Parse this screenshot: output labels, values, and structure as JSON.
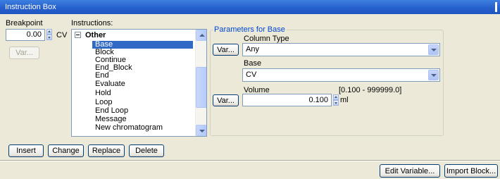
{
  "window": {
    "title": "Instruction Box"
  },
  "breakpoint": {
    "label": "Breakpoint",
    "value": "0.00",
    "unit": "CV",
    "var_button": "Var..."
  },
  "instructions": {
    "label": "Instructions:",
    "group": "Other",
    "items": [
      {
        "label": "Base",
        "selected": true
      },
      {
        "label": "Block"
      },
      {
        "label": "Continue"
      },
      {
        "label": "End_Block"
      },
      {
        "label": "End"
      },
      {
        "label": "Evaluate"
      },
      {
        "label": "Hold"
      },
      {
        "label": "Loop"
      },
      {
        "label": "End Loop"
      },
      {
        "label": "Message"
      },
      {
        "label": "New chromatogram"
      }
    ]
  },
  "parameters": {
    "title": "Parameters for Base",
    "column_type": {
      "label": "Column Type",
      "value": "Any",
      "var_button": "Var..."
    },
    "base": {
      "label": "Base",
      "value": "CV"
    },
    "volume": {
      "label": "Volume",
      "range": "[0.100 - 999999.0]",
      "value": "0.100",
      "unit": "ml",
      "var_button": "Var..."
    }
  },
  "actions": {
    "insert": "Insert",
    "change": "Change",
    "replace": "Replace",
    "delete": "Delete"
  },
  "footer": {
    "edit_variable": "Edit Variable...",
    "import_block": "Import Block..."
  },
  "colors": {
    "titlebar": "#2660cc",
    "selection": "#316ac5",
    "group_title": "#0046d5",
    "face": "#ece9d8"
  }
}
